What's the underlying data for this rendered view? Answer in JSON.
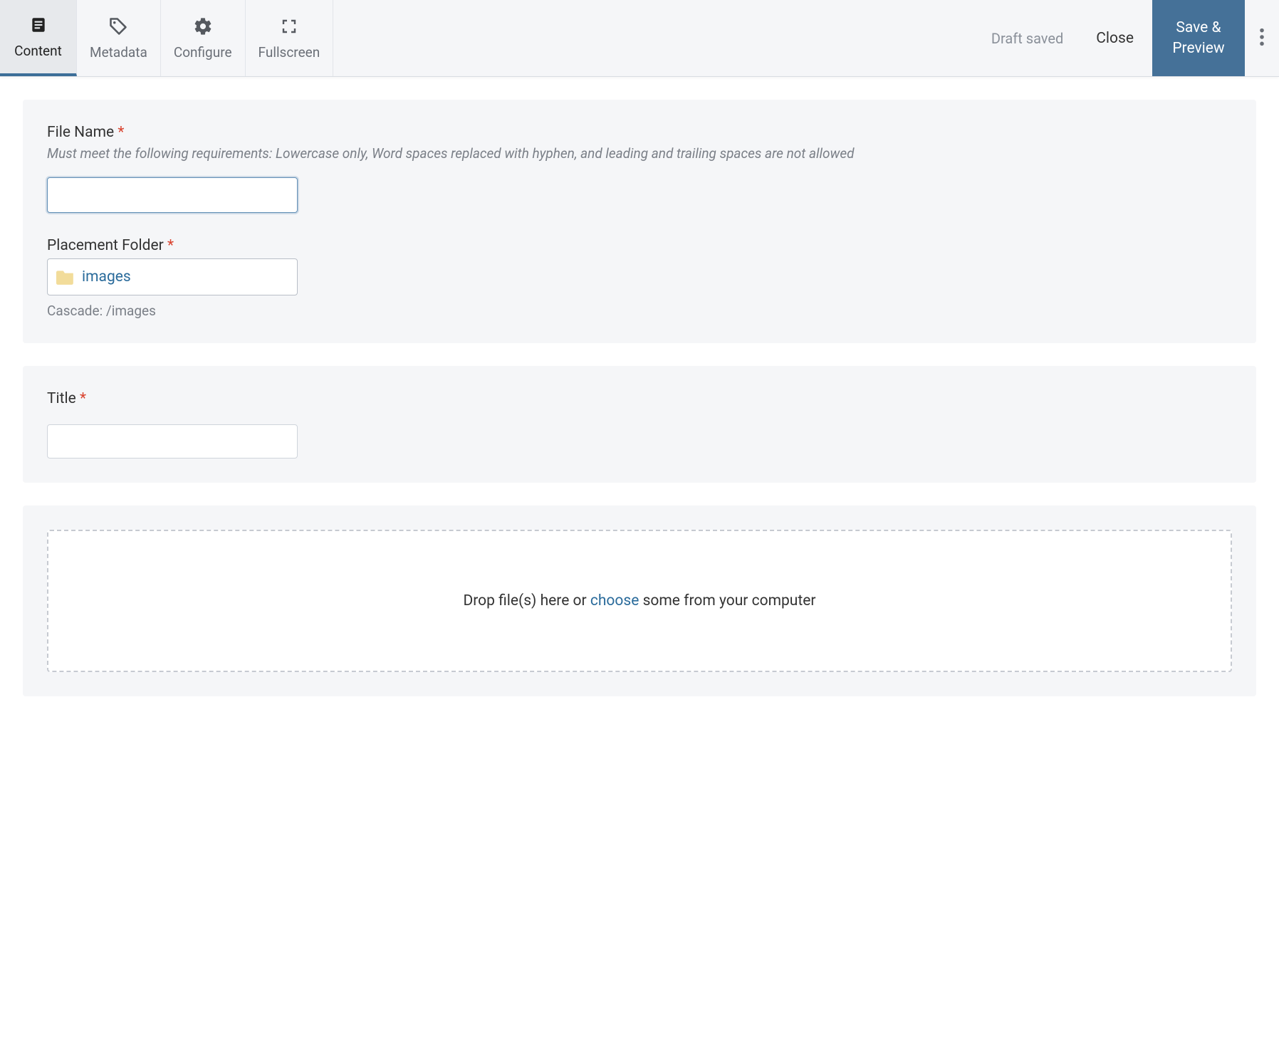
{
  "toolbar": {
    "tabs": [
      {
        "label": "Content"
      },
      {
        "label": "Metadata"
      },
      {
        "label": "Configure"
      },
      {
        "label": "Fullscreen"
      }
    ],
    "status": "Draft saved",
    "close_label": "Close",
    "save_label": "Save &\nPreview"
  },
  "panel1": {
    "filename": {
      "label": "File Name",
      "hint": "Must meet the following requirements: Lowercase only, Word spaces replaced with hyphen, and leading and trailing spaces are not allowed",
      "value": ""
    },
    "placement": {
      "label": "Placement Folder",
      "value": "images",
      "path": "Cascade: /images"
    }
  },
  "panel2": {
    "title_field": {
      "label": "Title",
      "value": ""
    }
  },
  "panel3": {
    "drop_pre": "Drop file(s) here or ",
    "drop_link": "choose",
    "drop_post": " some from your computer"
  },
  "required_mark": "*"
}
